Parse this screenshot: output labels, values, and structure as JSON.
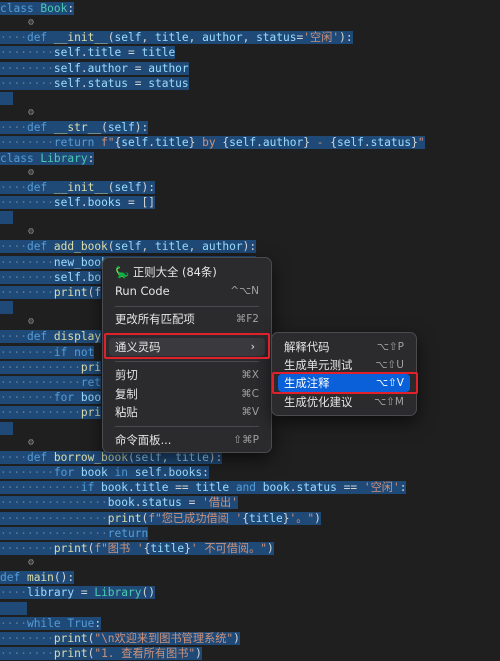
{
  "code_lines": [
    {
      "tokens": [
        [
          "kw",
          "class "
        ],
        [
          "cls",
          "Book"
        ],
        [
          "op",
          ":"
        ]
      ]
    },
    {
      "lens": "⚙"
    },
    {
      "tokens": [
        [
          "ws",
          "····"
        ],
        [
          "kw",
          "def "
        ],
        [
          "fn",
          "__init__"
        ],
        [
          "op",
          "("
        ],
        [
          "var",
          "self"
        ],
        [
          "op",
          ", "
        ],
        [
          "var",
          "title"
        ],
        [
          "op",
          ", "
        ],
        [
          "var",
          "author"
        ],
        [
          "op",
          ", "
        ],
        [
          "var",
          "status"
        ],
        [
          "op",
          "="
        ],
        [
          "str",
          "'空闲'"
        ],
        [
          "op",
          "):"
        ]
      ]
    },
    {
      "tokens": [
        [
          "ws",
          "········"
        ],
        [
          "var",
          "self"
        ],
        [
          "op",
          "."
        ],
        [
          "var",
          "title"
        ],
        [
          "op",
          " = "
        ],
        [
          "var",
          "title"
        ]
      ]
    },
    {
      "tokens": [
        [
          "ws",
          "········"
        ],
        [
          "var",
          "self"
        ],
        [
          "op",
          "."
        ],
        [
          "var",
          "author"
        ],
        [
          "op",
          " = "
        ],
        [
          "var",
          "author"
        ]
      ]
    },
    {
      "tokens": [
        [
          "ws",
          "········"
        ],
        [
          "var",
          "self"
        ],
        [
          "op",
          "."
        ],
        [
          "var",
          "status"
        ],
        [
          "op",
          " = "
        ],
        [
          "var",
          "status"
        ]
      ]
    },
    {
      "tokens": [
        [
          "ws",
          "  "
        ]
      ]
    },
    {
      "lens": "⚙"
    },
    {
      "tokens": [
        [
          "ws",
          "····"
        ],
        [
          "kw",
          "def "
        ],
        [
          "fn",
          "__str__"
        ],
        [
          "op",
          "("
        ],
        [
          "var",
          "self"
        ],
        [
          "op",
          "):"
        ]
      ]
    },
    {
      "tokens": [
        [
          "ws",
          "········"
        ],
        [
          "kw",
          "return "
        ],
        [
          "str",
          "f\""
        ],
        [
          "op",
          "{"
        ],
        [
          "var",
          "self"
        ],
        [
          "op",
          "."
        ],
        [
          "var",
          "title"
        ],
        [
          "op",
          "}"
        ],
        [
          "str",
          " by "
        ],
        [
          "op",
          "{"
        ],
        [
          "var",
          "self"
        ],
        [
          "op",
          "."
        ],
        [
          "var",
          "author"
        ],
        [
          "op",
          "}"
        ],
        [
          "str",
          " - "
        ],
        [
          "op",
          "{"
        ],
        [
          "var",
          "self"
        ],
        [
          "op",
          "."
        ],
        [
          "var",
          "status"
        ],
        [
          "op",
          "}"
        ],
        [
          "str",
          "\""
        ]
      ]
    },
    {
      "tokens": [
        [
          "kw",
          "class "
        ],
        [
          "cls",
          "Library"
        ],
        [
          "op",
          ":"
        ]
      ]
    },
    {
      "lens": "⚙"
    },
    {
      "tokens": [
        [
          "ws",
          "····"
        ],
        [
          "kw",
          "def "
        ],
        [
          "fn",
          "__init__"
        ],
        [
          "op",
          "("
        ],
        [
          "var",
          "self"
        ],
        [
          "op",
          "):"
        ]
      ]
    },
    {
      "tokens": [
        [
          "ws",
          "········"
        ],
        [
          "var",
          "self"
        ],
        [
          "op",
          "."
        ],
        [
          "var",
          "books"
        ],
        [
          "op",
          " = []"
        ]
      ]
    },
    {
      "tokens": [
        [
          "ws",
          "  "
        ]
      ]
    },
    {
      "lens": "⚙"
    },
    {
      "tokens": [
        [
          "ws",
          "····"
        ],
        [
          "kw",
          "def "
        ],
        [
          "fn",
          "add_book"
        ],
        [
          "op",
          "("
        ],
        [
          "var",
          "self"
        ],
        [
          "op",
          ", "
        ],
        [
          "var",
          "title"
        ],
        [
          "op",
          ", "
        ],
        [
          "var",
          "author"
        ],
        [
          "op",
          "):"
        ]
      ]
    },
    {
      "tokens": [
        [
          "ws",
          "········"
        ],
        [
          "var",
          "new_book"
        ],
        [
          "op",
          " = "
        ],
        [
          "cls",
          "Book"
        ],
        [
          "op",
          "("
        ],
        [
          "var",
          "title"
        ],
        [
          "op",
          ", "
        ],
        [
          "var",
          "author"
        ],
        [
          "op",
          ")"
        ]
      ]
    },
    {
      "tokens": [
        [
          "ws",
          "········"
        ],
        [
          "var",
          "self"
        ],
        [
          "op",
          "."
        ],
        [
          "var",
          "bo"
        ]
      ]
    },
    {
      "tokens": [
        [
          "ws",
          "········"
        ],
        [
          "fn",
          "print"
        ],
        [
          "op",
          "(f"
        ]
      ]
    },
    {
      "tokens": [
        [
          "ws",
          "  "
        ]
      ]
    },
    {
      "lens": "⚙"
    },
    {
      "tokens": [
        [
          "ws",
          "····"
        ],
        [
          "kw",
          "def "
        ],
        [
          "fn",
          "display"
        ]
      ]
    },
    {
      "tokens": [
        [
          "ws",
          "········"
        ],
        [
          "kw",
          "if "
        ],
        [
          "kw",
          "not"
        ]
      ]
    },
    {
      "tokens": [
        [
          "ws",
          "············"
        ],
        [
          "fn",
          "pri"
        ]
      ]
    },
    {
      "tokens": [
        [
          "ws",
          "············"
        ],
        [
          "kw",
          "ret"
        ]
      ]
    },
    {
      "tokens": [
        [
          "ws",
          "········"
        ],
        [
          "kw",
          "for "
        ],
        [
          "var",
          "boo"
        ]
      ]
    },
    {
      "tokens": [
        [
          "ws",
          "············"
        ],
        [
          "fn",
          "pri"
        ]
      ]
    },
    {
      "tokens": [
        [
          "ws",
          "  "
        ]
      ]
    },
    {
      "lens": "⚙"
    },
    {
      "tokens": [
        [
          "ws",
          "····"
        ],
        [
          "kw",
          "def "
        ],
        [
          "fn",
          "borrow_book"
        ],
        [
          "op",
          "("
        ],
        [
          "var",
          "self"
        ],
        [
          "op",
          ", "
        ],
        [
          "var",
          "title"
        ],
        [
          "op",
          "):"
        ]
      ]
    },
    {
      "tokens": [
        [
          "ws",
          "········"
        ],
        [
          "kw",
          "for "
        ],
        [
          "var",
          "book"
        ],
        [
          "kw",
          " in "
        ],
        [
          "var",
          "self"
        ],
        [
          "op",
          "."
        ],
        [
          "var",
          "books"
        ],
        [
          "op",
          ":"
        ]
      ]
    },
    {
      "tokens": [
        [
          "ws",
          "············"
        ],
        [
          "kw",
          "if "
        ],
        [
          "var",
          "book"
        ],
        [
          "op",
          "."
        ],
        [
          "var",
          "title"
        ],
        [
          "op",
          " == "
        ],
        [
          "var",
          "title"
        ],
        [
          "kw",
          " and "
        ],
        [
          "var",
          "book"
        ],
        [
          "op",
          "."
        ],
        [
          "var",
          "status"
        ],
        [
          "op",
          " == "
        ],
        [
          "str",
          "'空闲'"
        ],
        [
          "op",
          ":"
        ]
      ]
    },
    {
      "tokens": [
        [
          "ws",
          "················"
        ],
        [
          "var",
          "book"
        ],
        [
          "op",
          "."
        ],
        [
          "var",
          "status"
        ],
        [
          "op",
          " = "
        ],
        [
          "str",
          "'借出'"
        ]
      ]
    },
    {
      "tokens": [
        [
          "ws",
          "················"
        ],
        [
          "fn",
          "print"
        ],
        [
          "op",
          "("
        ],
        [
          "str",
          "f\"您已成功借阅 '"
        ],
        [
          "op",
          "{"
        ],
        [
          "var",
          "title"
        ],
        [
          "op",
          "}"
        ],
        [
          "str",
          "'。\""
        ],
        [
          "op",
          ")"
        ]
      ]
    },
    {
      "tokens": [
        [
          "ws",
          "················"
        ],
        [
          "kw",
          "return"
        ]
      ]
    },
    {
      "tokens": [
        [
          "ws",
          "········"
        ],
        [
          "fn",
          "print"
        ],
        [
          "op",
          "("
        ],
        [
          "str",
          "f\"图书 '"
        ],
        [
          "op",
          "{"
        ],
        [
          "var",
          "title"
        ],
        [
          "op",
          "}"
        ],
        [
          "str",
          "' 不可借阅。\""
        ],
        [
          "op",
          ")"
        ]
      ]
    },
    {
      "lens": "⚙"
    },
    {
      "tokens": [
        [
          "kw",
          "def "
        ],
        [
          "fn",
          "main"
        ],
        [
          "op",
          "():"
        ]
      ]
    },
    {
      "tokens": [
        [
          "ws",
          "····"
        ],
        [
          "var",
          "library"
        ],
        [
          "op",
          " = "
        ],
        [
          "cls",
          "Library"
        ],
        [
          "op",
          "()"
        ]
      ]
    },
    {
      "tokens": [
        [
          "ws",
          "    "
        ]
      ]
    },
    {
      "tokens": [
        [
          "ws",
          "····"
        ],
        [
          "kw",
          "while "
        ],
        [
          "kw",
          "True"
        ],
        [
          "op",
          ":"
        ]
      ]
    },
    {
      "tokens": [
        [
          "ws",
          "········"
        ],
        [
          "fn",
          "print"
        ],
        [
          "op",
          "("
        ],
        [
          "str",
          "\"\\n欢迎来到图书管理系统\""
        ],
        [
          "op",
          ")"
        ]
      ]
    },
    {
      "tokens": [
        [
          "ws",
          "········"
        ],
        [
          "fn",
          "print"
        ],
        [
          "op",
          "("
        ],
        [
          "str",
          "\"1. 查看所有图书\""
        ],
        [
          "op",
          ")"
        ]
      ]
    }
  ],
  "context_menu": {
    "items": [
      {
        "icon": "🦕",
        "label": "正则大全 (84条)",
        "shortcut": ""
      },
      {
        "label": "Run Code",
        "shortcut": "^⌥N"
      },
      {
        "label": "更改所有匹配项",
        "shortcut": "⌘F2"
      },
      {
        "label": "通义灵码",
        "shortcut": ""
      },
      {
        "label": "剪切",
        "shortcut": "⌘X"
      },
      {
        "label": "复制",
        "shortcut": "⌘C"
      },
      {
        "label": "粘贴",
        "shortcut": "⌘V"
      },
      {
        "label": "命令面板...",
        "shortcut": "⇧⌘P"
      }
    ],
    "submenu_arrow": "›"
  },
  "submenu": {
    "items": [
      {
        "label": "解释代码",
        "shortcut": "⌥⇧P"
      },
      {
        "label": "生成单元测试",
        "shortcut": "⌥⇧U"
      },
      {
        "label": "生成注释",
        "shortcut": "⌥⇧V"
      },
      {
        "label": "生成优化建议",
        "shortcut": "⌥⇧M"
      }
    ]
  },
  "colors": {
    "accent": "#0a60d9",
    "highlight": "#e0202a",
    "selection": "#1f4a78"
  }
}
